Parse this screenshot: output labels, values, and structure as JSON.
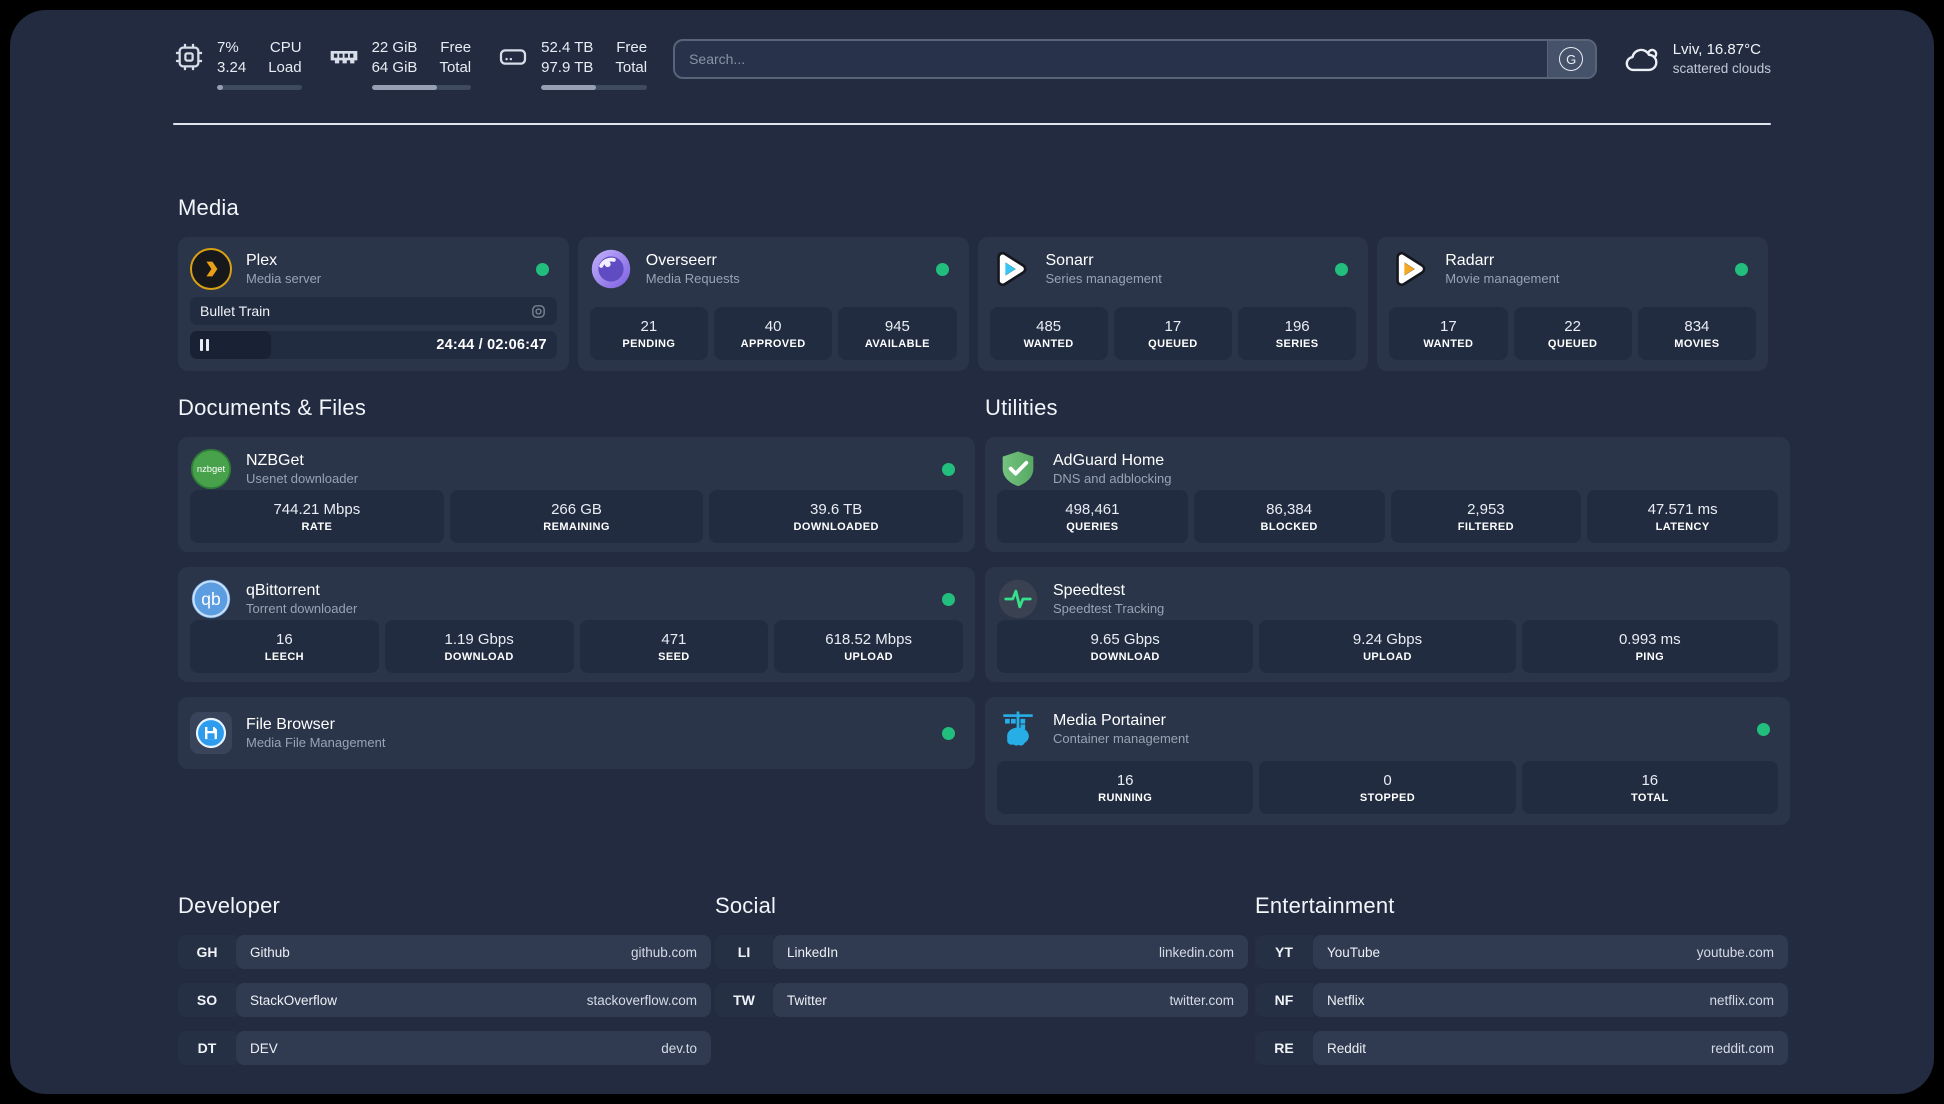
{
  "topbar": {
    "cpu": {
      "icon": "cpu-icon",
      "value_line1": "7%",
      "value_line2": "3.24",
      "label_line1": "CPU",
      "label_line2": "Load",
      "progress_pct": 7
    },
    "memory": {
      "icon": "ram-icon",
      "value_line1": "22 GiB",
      "value_line2": "64 GiB",
      "label_line1": "Free",
      "label_line2": "Total",
      "progress_pct": 66
    },
    "disk": {
      "icon": "disk-icon",
      "value_line1": "52.4 TB",
      "value_line2": "97.9 TB",
      "label_line1": "Free",
      "label_line2": "Total",
      "progress_pct": 52
    },
    "search": {
      "placeholder": "Search...",
      "provider_button": "G"
    },
    "weather": {
      "icon": "cloud-icon",
      "location": "Lviv, 16.87°C",
      "condition": "scattered clouds"
    }
  },
  "sections": {
    "media": {
      "title": "Media",
      "cards": [
        {
          "icon": "plex-icon",
          "name": "Plex",
          "subtitle": "Media server",
          "status": "online",
          "now_playing": {
            "title": "Bullet Train",
            "time": "24:44 / 02:06:47",
            "progress_pct": 22
          }
        },
        {
          "icon": "overseerr-icon",
          "name": "Overseerr",
          "subtitle": "Media Requests",
          "status": "online",
          "stats": [
            {
              "value": "21",
              "label": "PENDING"
            },
            {
              "value": "40",
              "label": "APPROVED"
            },
            {
              "value": "945",
              "label": "AVAILABLE"
            }
          ]
        },
        {
          "icon": "sonarr-icon",
          "name": "Sonarr",
          "subtitle": "Series management",
          "status": "online",
          "stats": [
            {
              "value": "485",
              "label": "WANTED"
            },
            {
              "value": "17",
              "label": "QUEUED"
            },
            {
              "value": "196",
              "label": "SERIES"
            }
          ]
        },
        {
          "icon": "radarr-icon",
          "name": "Radarr",
          "subtitle": "Movie management",
          "status": "online",
          "stats": [
            {
              "value": "17",
              "label": "WANTED"
            },
            {
              "value": "22",
              "label": "QUEUED"
            },
            {
              "value": "834",
              "label": "MOVIES"
            }
          ]
        }
      ]
    },
    "documents": {
      "title": "Documents & Files",
      "cards": [
        {
          "icon": "nzbget-icon",
          "name": "NZBGet",
          "subtitle": "Usenet downloader",
          "status": "online",
          "stats": [
            {
              "value": "744.21 Mbps",
              "label": "RATE"
            },
            {
              "value": "266 GB",
              "label": "REMAINING"
            },
            {
              "value": "39.6 TB",
              "label": "DOWNLOADED"
            }
          ]
        },
        {
          "icon": "qbittorrent-icon",
          "name": "qBittorrent",
          "subtitle": "Torrent downloader",
          "status": "online",
          "stats": [
            {
              "value": "16",
              "label": "LEECH"
            },
            {
              "value": "1.19 Gbps",
              "label": "DOWNLOAD"
            },
            {
              "value": "471",
              "label": "SEED"
            },
            {
              "value": "618.52 Mbps",
              "label": "UPLOAD"
            }
          ]
        },
        {
          "icon": "filebrowser-icon",
          "name": "File Browser",
          "subtitle": "Media File Management",
          "status": "online",
          "stats": []
        }
      ]
    },
    "utilities": {
      "title": "Utilities",
      "cards": [
        {
          "icon": "adguard-icon",
          "name": "AdGuard Home",
          "subtitle": "DNS and adblocking",
          "status": "none",
          "stats": [
            {
              "value": "498,461",
              "label": "QUERIES"
            },
            {
              "value": "86,384",
              "label": "BLOCKED"
            },
            {
              "value": "2,953",
              "label": "FILTERED"
            },
            {
              "value": "47.571 ms",
              "label": "LATENCY"
            }
          ]
        },
        {
          "icon": "speedtest-icon",
          "name": "Speedtest",
          "subtitle": "Speedtest Tracking",
          "status": "none",
          "stats": [
            {
              "value": "9.65 Gbps",
              "label": "DOWNLOAD"
            },
            {
              "value": "9.24 Gbps",
              "label": "UPLOAD"
            },
            {
              "value": "0.993 ms",
              "label": "PING"
            }
          ]
        },
        {
          "icon": "portainer-icon",
          "name": "Media Portainer",
          "subtitle": "Container management",
          "status": "online",
          "stats": [
            {
              "value": "16",
              "label": "RUNNING"
            },
            {
              "value": "0",
              "label": "STOPPED"
            },
            {
              "value": "16",
              "label": "TOTAL"
            }
          ]
        }
      ]
    },
    "developer": {
      "title": "Developer",
      "links": [
        {
          "abbr": "GH",
          "name": "Github",
          "url": "github.com"
        },
        {
          "abbr": "SO",
          "name": "StackOverflow",
          "url": "stackoverflow.com"
        },
        {
          "abbr": "DT",
          "name": "DEV",
          "url": "dev.to"
        }
      ]
    },
    "social": {
      "title": "Social",
      "links": [
        {
          "abbr": "LI",
          "name": "LinkedIn",
          "url": "linkedin.com"
        },
        {
          "abbr": "TW",
          "name": "Twitter",
          "url": "twitter.com"
        }
      ]
    },
    "entertainment": {
      "title": "Entertainment",
      "links": [
        {
          "abbr": "YT",
          "name": "YouTube",
          "url": "youtube.com"
        },
        {
          "abbr": "NF",
          "name": "Netflix",
          "url": "netflix.com"
        },
        {
          "abbr": "RE",
          "name": "Reddit",
          "url": "reddit.com"
        }
      ]
    }
  },
  "colors": {
    "background": "#222B40",
    "card": "#2A3549",
    "tile": "#222C40",
    "status_online": "#21BE7D"
  }
}
